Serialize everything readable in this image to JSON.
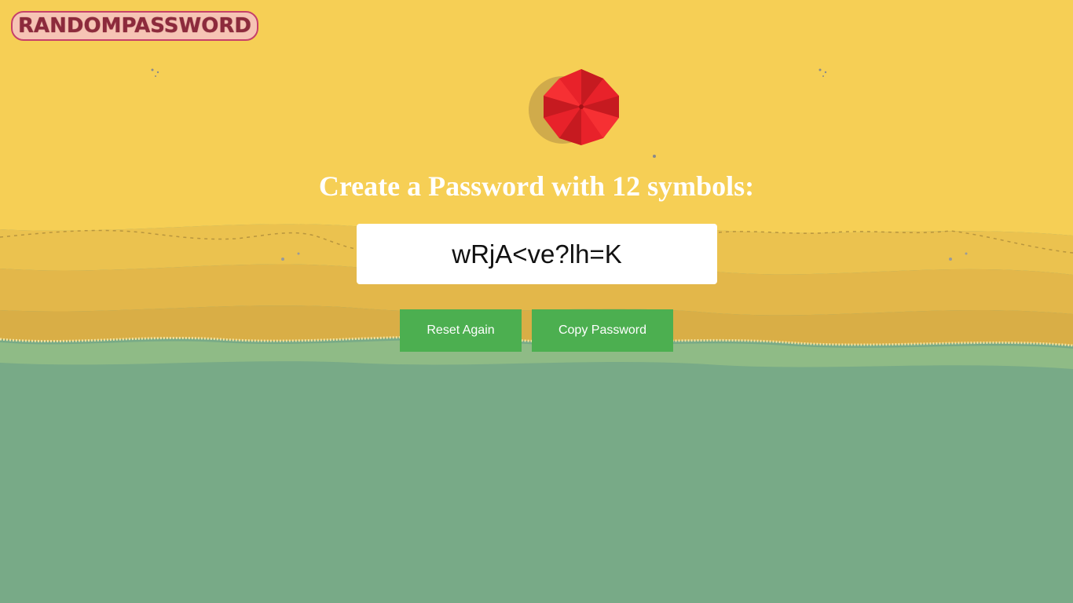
{
  "logo": {
    "text": "RANDOMPASSWORD"
  },
  "heading": {
    "text": "Create a Password with 12 symbols:"
  },
  "password": {
    "value": "wRjA<ve?lh=K"
  },
  "buttons": {
    "reset_label": "Reset Again",
    "copy_label": "Copy Password"
  },
  "colors": {
    "sand": "#f6cf55",
    "sea": "#78aa87",
    "button": "#4caf50",
    "umbrella": "#e8222a",
    "logo_text": "#8c2a3c"
  },
  "icons": {
    "umbrella": "beach-umbrella-icon"
  }
}
